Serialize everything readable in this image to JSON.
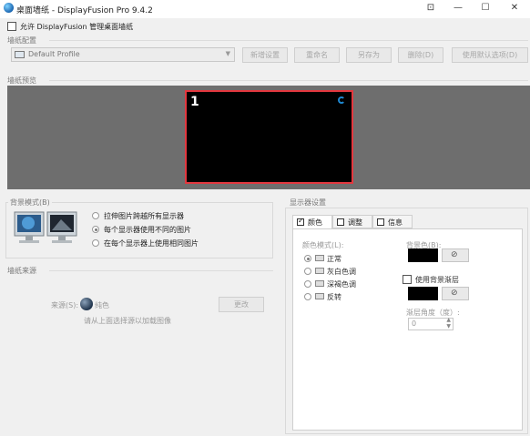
{
  "window": {
    "title": "桌面墙纸 - DisplayFusion Pro 9.4.2",
    "buttons": {
      "minimize": "—",
      "maximize": "☐",
      "close": "✕",
      "extra": "⊡"
    }
  },
  "allow_manage": {
    "label": "允许 DisplayFusion 管理桌面墙纸",
    "checked": false
  },
  "profile": {
    "title": "墙纸配置",
    "selected": "Default Profile",
    "buttons": {
      "new": "新增设置",
      "rename": "重命名",
      "save_as": "另存为",
      "delete": "删除(D)",
      "use_default": "使用默认选项(D)"
    }
  },
  "preview": {
    "title": "墙纸预览",
    "monitor_number": "1"
  },
  "bg_mode": {
    "title": "背景模式(B)",
    "options": [
      {
        "label": "拉伸图片跨越所有显示器",
        "selected": false
      },
      {
        "label": "每个显示器使用不同的图片",
        "selected": true
      },
      {
        "label": "在每个显示器上使用相同图片",
        "selected": false
      }
    ]
  },
  "source": {
    "title": "墙纸来源",
    "source_label": "来源(S):",
    "source_value": "纯色",
    "change_button": "更改",
    "hint": "请从上面选择源以加载图像"
  },
  "monitor_settings": {
    "title": "显示器设置",
    "tabs": [
      {
        "label": "颜色",
        "checked": true,
        "active": true
      },
      {
        "label": "调整",
        "checked": false,
        "active": false
      },
      {
        "label": "信息",
        "checked": false,
        "active": false
      }
    ],
    "color_mode": {
      "title": "颜色模式(L):",
      "options": [
        {
          "label": "正常",
          "selected": true
        },
        {
          "label": "灰白色调",
          "selected": false
        },
        {
          "label": "深褐色调",
          "selected": false
        },
        {
          "label": "反转",
          "selected": false
        }
      ]
    },
    "bg_color": {
      "label": "背景色(B):",
      "color": "#000000"
    },
    "use_gradient": {
      "label": "使用背景渐层",
      "checked": false
    },
    "gradient_color": {
      "color": "#000000"
    },
    "gradient_angle": {
      "label": "渐层角度（度）:",
      "value": "0"
    },
    "picker_icon": "eyedropper-icon"
  },
  "colors": {
    "accent_border": "#e3383f",
    "preview_bg": "#6e6e6e"
  }
}
